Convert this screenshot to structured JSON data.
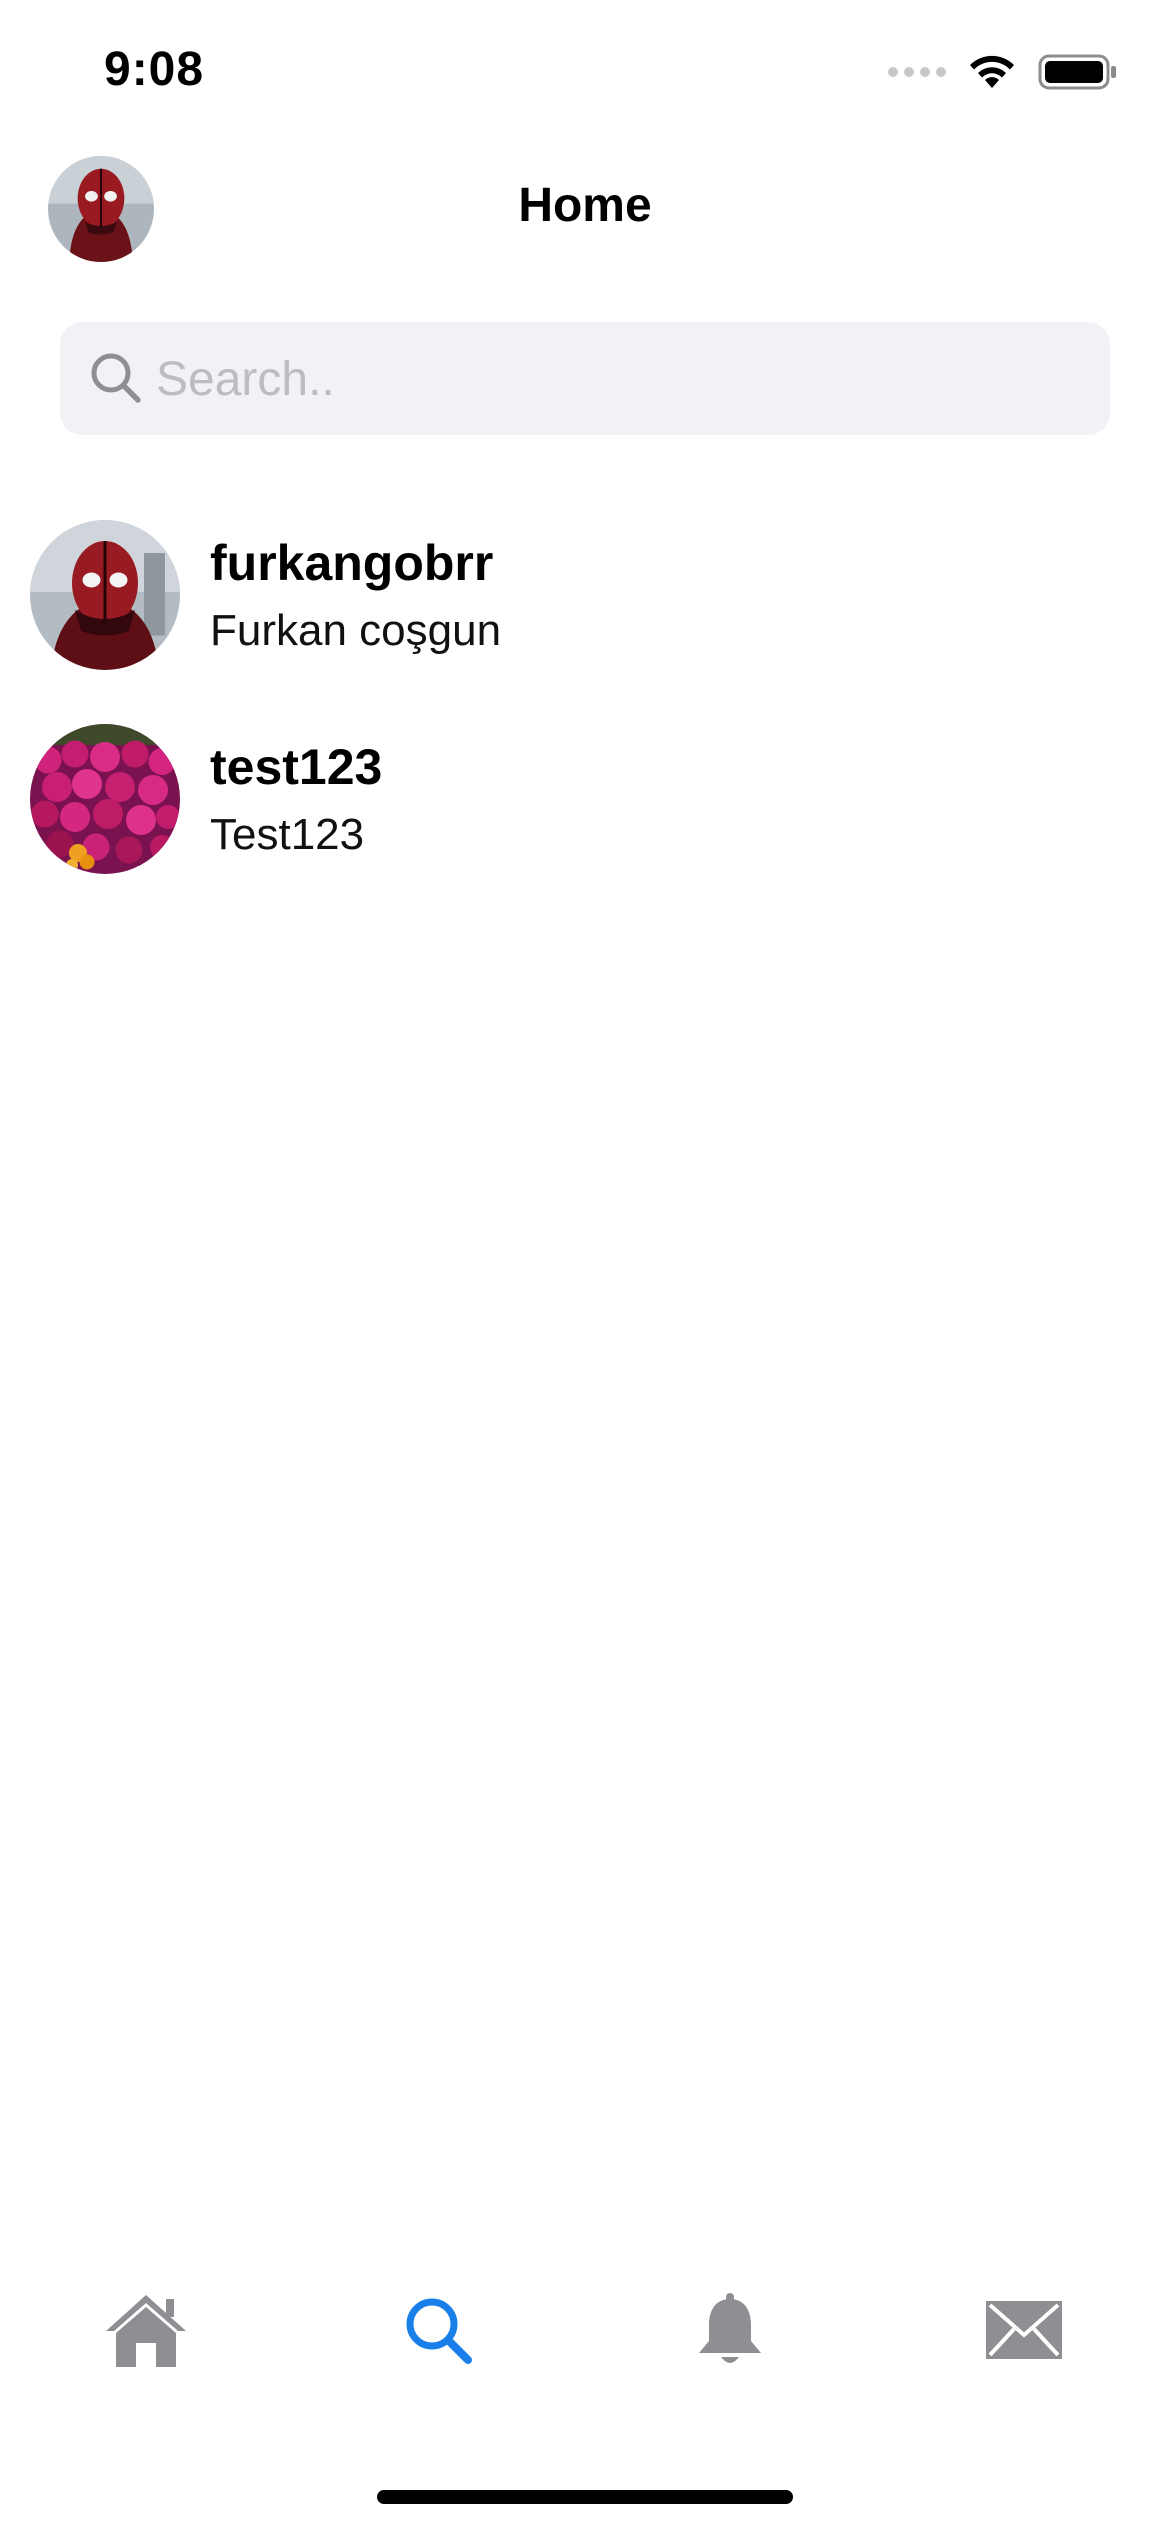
{
  "status_bar": {
    "time": "9:08",
    "icons": [
      "signal-dots-icon",
      "wifi-icon",
      "battery-icon"
    ]
  },
  "header": {
    "title": "Home",
    "avatar": "profile-avatar-deadpool"
  },
  "search": {
    "placeholder": "Search..",
    "value": "",
    "icon": "search-icon"
  },
  "users": [
    {
      "username": "furkangobrr",
      "full_name": "Furkan coşgun",
      "avatar": "deadpool-avatar"
    },
    {
      "username": "test123",
      "full_name": "Test123",
      "avatar": "pink-flowers-avatar"
    }
  ],
  "tab_bar": {
    "tabs": [
      {
        "name": "home",
        "icon": "home-icon",
        "active": false
      },
      {
        "name": "search",
        "icon": "search-icon",
        "active": true
      },
      {
        "name": "notifications",
        "icon": "bell-icon",
        "active": false
      },
      {
        "name": "messages",
        "icon": "mail-icon",
        "active": false
      }
    ]
  },
  "colors": {
    "accent": "#1a7fe8",
    "inactive_icon": "#8e8e93",
    "search_background": "#f2f2f6",
    "placeholder": "#bcbcc2"
  }
}
